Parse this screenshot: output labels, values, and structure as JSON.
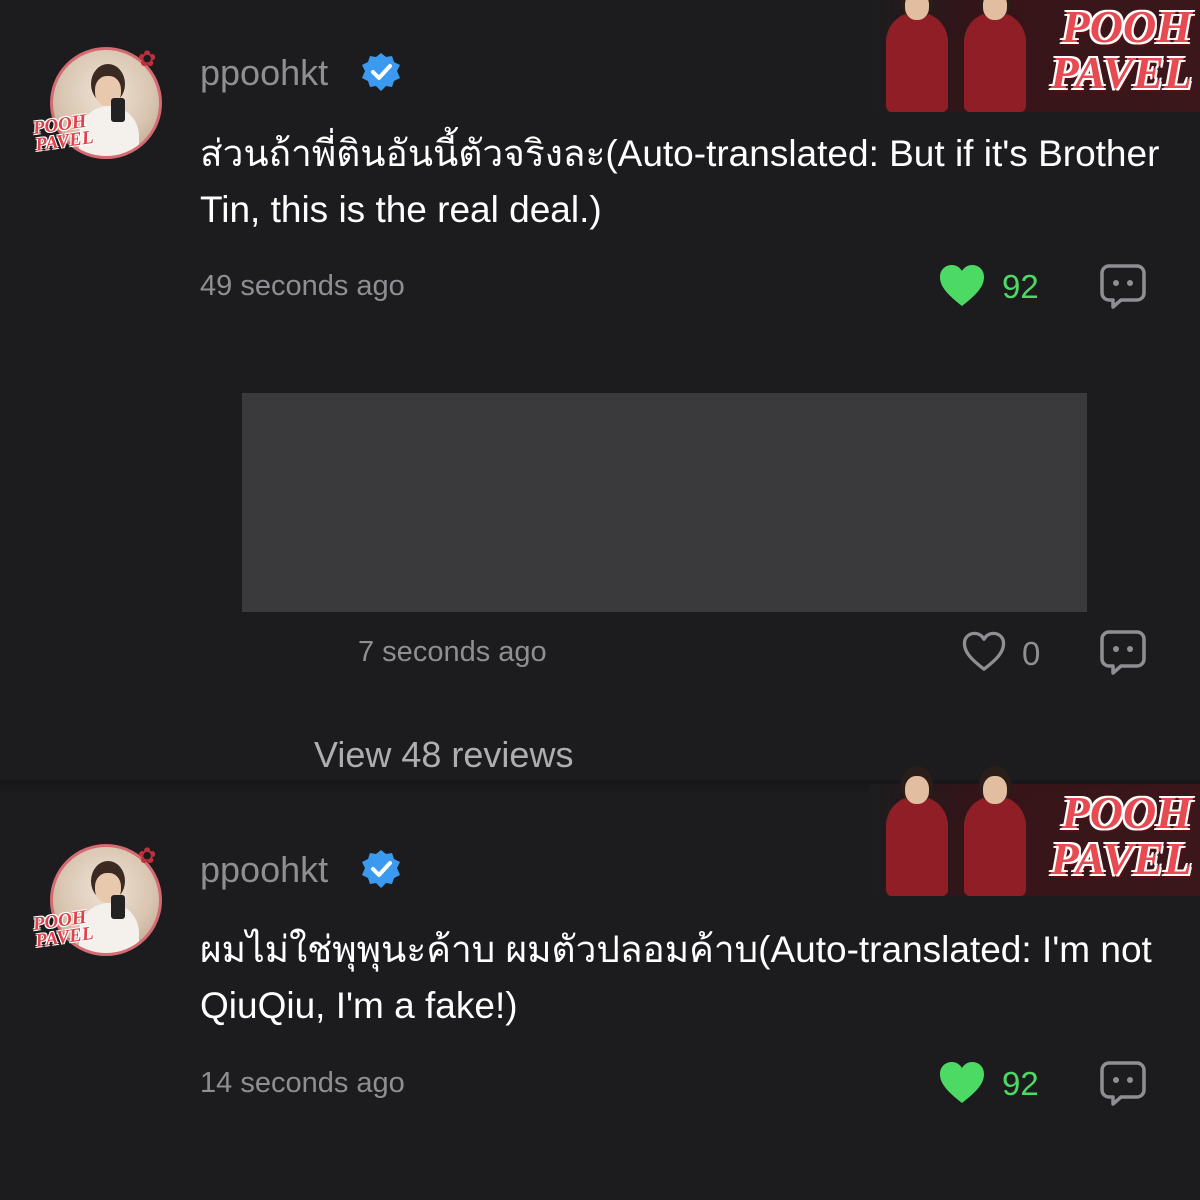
{
  "comments": [
    {
      "username": "ppoohkt",
      "text": "ส่วนถ้าพี่ตินอันนี้ตัวจริงละ(Auto-translated: But if it's Brother Tin, this is the real deal.)",
      "timestamp": "49 seconds ago",
      "likes": "92",
      "liked": true,
      "avatar_logo_line1": "POOH",
      "avatar_logo_line2": "PAVEL"
    },
    {
      "username": "ppoohkt",
      "text": "ผมไม่ใช่พุพุนะค้าบ ผมตัวปลอมค้าบ(Auto-translated: I'm not QiuQiu, I'm a fake!)",
      "timestamp": "14 seconds ago",
      "likes": "92",
      "liked": true,
      "avatar_logo_line1": "POOH",
      "avatar_logo_line2": "PAVEL"
    }
  ],
  "reply": {
    "timestamp": "7 seconds ago",
    "likes": "0",
    "liked": false
  },
  "view_reviews_label": "View 48 reviews",
  "banner": {
    "logo_line1": "POOH",
    "logo_line2": "PAVEL"
  },
  "icons": {
    "verified": "verified-badge-icon",
    "like_filled": "heart-filled-icon",
    "like_outline": "heart-outline-icon",
    "reply": "comment-bubble-icon"
  },
  "colors": {
    "background": "#1c1c1e",
    "muted_text": "#8e8e93",
    "like_active": "#4cd964",
    "verified_blue": "#3b9af0",
    "brand_red": "#e84a52"
  }
}
